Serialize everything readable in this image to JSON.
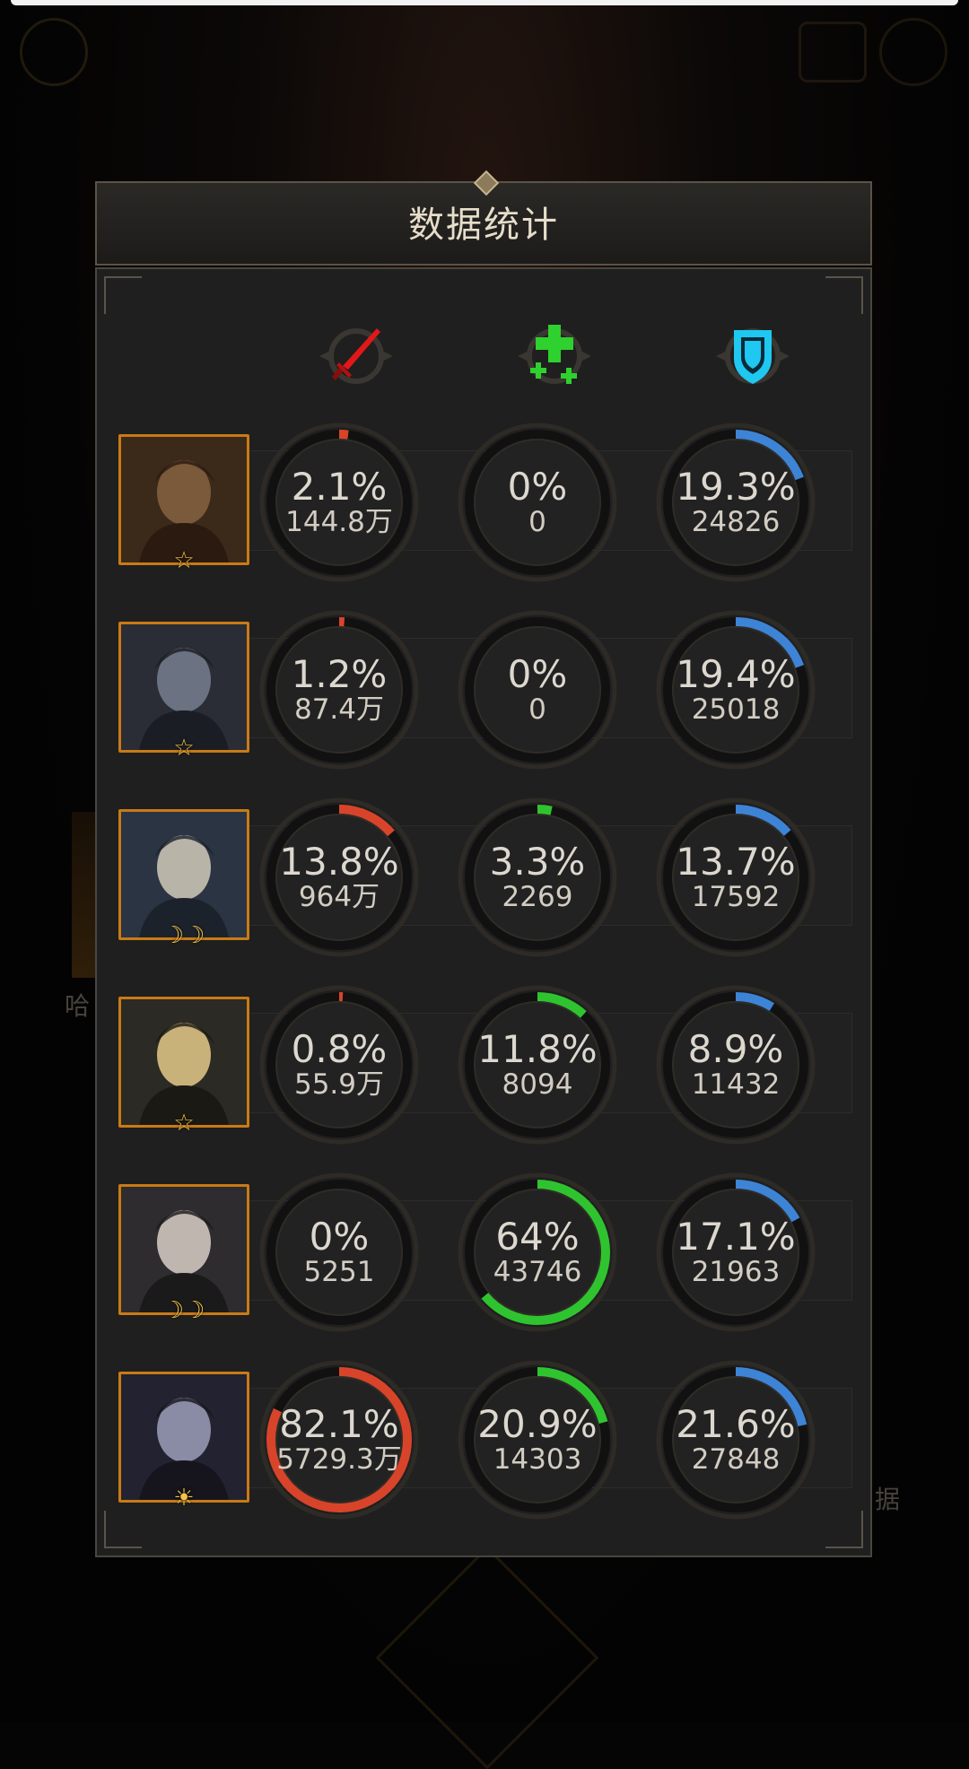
{
  "panel": {
    "title": "数据统计"
  },
  "columns": [
    {
      "icon": "sword-icon",
      "color": "#e02020"
    },
    {
      "icon": "heal-plus-icon",
      "color": "#2ed12e"
    },
    {
      "icon": "shield-icon",
      "color": "#1ec8f0"
    }
  ],
  "ring_colors": {
    "damage": "#d8442a",
    "heal": "#2fc42f",
    "tank": "#3d84d6",
    "track": "#111111"
  },
  "background": {
    "left_label": "哈",
    "right_label": "据"
  },
  "rows": [
    {
      "hero": "bearded-warrior-portrait",
      "badge": "☆",
      "damage": {
        "pct": "2.1%",
        "value": "144.8万",
        "fraction": 0.021
      },
      "heal": {
        "pct": "0%",
        "value": "0",
        "fraction": 0
      },
      "tank": {
        "pct": "19.3%",
        "value": "24826",
        "fraction": 0.193
      }
    },
    {
      "hero": "wolf-portrait",
      "badge": "☆",
      "damage": {
        "pct": "1.2%",
        "value": "87.4万",
        "fraction": 0.012
      },
      "heal": {
        "pct": "0%",
        "value": "0",
        "fraction": 0
      },
      "tank": {
        "pct": "19.4%",
        "value": "25018",
        "fraction": 0.194
      }
    },
    {
      "hero": "elf-sorceress-portrait",
      "badge": "☽☽",
      "damage": {
        "pct": "13.8%",
        "value": "964万",
        "fraction": 0.138
      },
      "heal": {
        "pct": "3.3%",
        "value": "2269",
        "fraction": 0.033
      },
      "tank": {
        "pct": "13.7%",
        "value": "17592",
        "fraction": 0.137
      }
    },
    {
      "hero": "blonde-archer-portrait",
      "badge": "☆",
      "damage": {
        "pct": "0.8%",
        "value": "55.9万",
        "fraction": 0.008
      },
      "heal": {
        "pct": "11.8%",
        "value": "8094",
        "fraction": 0.118
      },
      "tank": {
        "pct": "8.9%",
        "value": "11432",
        "fraction": 0.089
      }
    },
    {
      "hero": "silver-priestess-portrait",
      "badge": "☽☽",
      "damage": {
        "pct": "0%",
        "value": "5251",
        "fraction": 0
      },
      "heal": {
        "pct": "64%",
        "value": "43746",
        "fraction": 0.64
      },
      "tank": {
        "pct": "17.1%",
        "value": "21963",
        "fraction": 0.171
      }
    },
    {
      "hero": "mystic-mage-portrait",
      "badge": "☀",
      "damage": {
        "pct": "82.1%",
        "value": "5729.3万",
        "fraction": 0.821
      },
      "heal": {
        "pct": "20.9%",
        "value": "14303",
        "fraction": 0.209
      },
      "tank": {
        "pct": "21.6%",
        "value": "27848",
        "fraction": 0.216
      }
    }
  ]
}
